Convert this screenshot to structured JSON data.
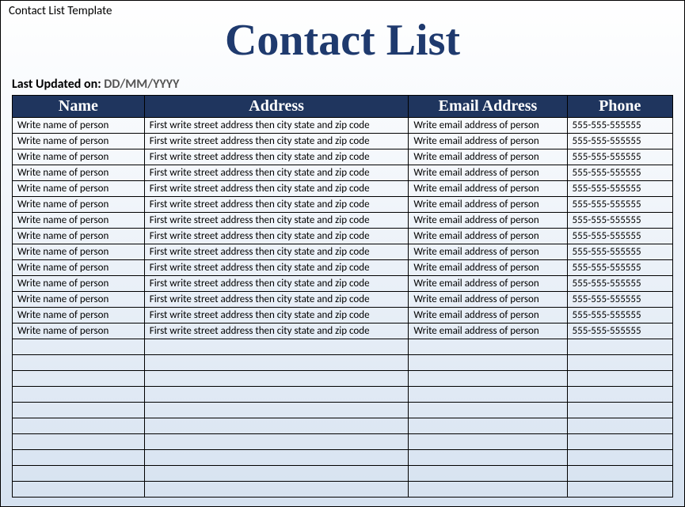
{
  "template_label": "Contact List Template",
  "title": "Contact List",
  "last_updated": {
    "label": "Last Updated on:",
    "value": "DD/MM/YYYY"
  },
  "table": {
    "headers": {
      "name": "Name",
      "address": "Address",
      "email": "Email Address",
      "phone": "Phone"
    },
    "rows": [
      {
        "name": "Write name of person",
        "address": "First write street address then city state and zip code",
        "email": "Write email address of person",
        "phone": "555-555-555555"
      },
      {
        "name": "Write name of person",
        "address": "First write street address then city state and zip code",
        "email": "Write email address of person",
        "phone": "555-555-555555"
      },
      {
        "name": "Write name of person",
        "address": "First write street address then city state and zip code",
        "email": "Write email address of person",
        "phone": "555-555-555555"
      },
      {
        "name": "Write name of person",
        "address": "First write street address then city state and zip code",
        "email": "Write email address of person",
        "phone": "555-555-555555"
      },
      {
        "name": "Write name of person",
        "address": "First write street address then city state and zip code",
        "email": "Write email address of person",
        "phone": "555-555-555555"
      },
      {
        "name": "Write name of person",
        "address": "First write street address then city state and zip code",
        "email": "Write email address of person",
        "phone": "555-555-555555"
      },
      {
        "name": "Write name of person",
        "address": "First write street address then city state and zip code",
        "email": "Write email address of person",
        "phone": "555-555-555555"
      },
      {
        "name": "Write name of person",
        "address": "First write street address then city state and zip code",
        "email": "Write email address of person",
        "phone": "555-555-555555"
      },
      {
        "name": "Write name of person",
        "address": "First write street address then city state and zip code",
        "email": "Write email address of person",
        "phone": "555-555-555555"
      },
      {
        "name": "Write name of person",
        "address": "First write street address then city state and zip code",
        "email": "Write email address of person",
        "phone": "555-555-555555"
      },
      {
        "name": "Write name of person",
        "address": "First write street address then city state and zip code",
        "email": "Write email address of person",
        "phone": "555-555-555555"
      },
      {
        "name": "Write name of person",
        "address": "First write street address then city state and zip code",
        "email": "Write email address of person",
        "phone": "555-555-555555"
      },
      {
        "name": "Write name of person",
        "address": "First write street address then city state and zip code",
        "email": "Write email address of person",
        "phone": "555-555-555555"
      },
      {
        "name": "Write name of person",
        "address": "First write street address then city state and zip code",
        "email": "Write email address of person",
        "phone": "555-555-555555"
      }
    ],
    "empty_row_count": 10
  }
}
